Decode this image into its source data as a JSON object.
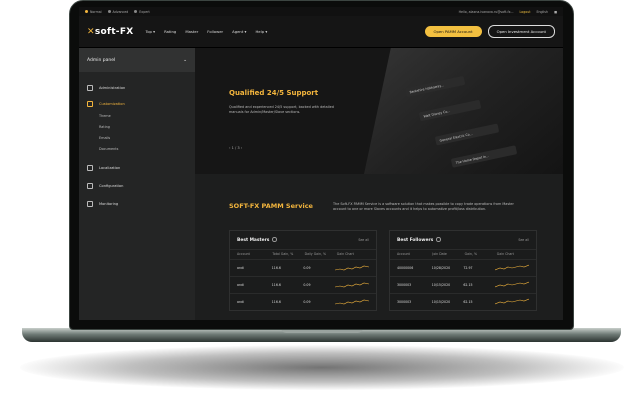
{
  "topbar": {
    "badges": [
      {
        "label": "Normal",
        "color": "#f3b53d"
      },
      {
        "label": "Advanced",
        "color": "#888888"
      },
      {
        "label": "Expert",
        "color": "#888888"
      }
    ],
    "email": "Hello, alaxna.ivanova.ru@soft-fx...",
    "login": "Logout",
    "lang": "English"
  },
  "nav": {
    "logo_x": "✕",
    "logo_text": "soft-FX",
    "items": [
      "Top ▾",
      "Rating",
      "Master",
      "Follower",
      "Agent ▾",
      "Help ▾"
    ],
    "open_pamm": "Open PAMM Account",
    "open_investment": "Open Investment Account"
  },
  "sidebar": {
    "title": "Admin panel",
    "items": [
      {
        "label": "Administration"
      },
      {
        "label": "Customization"
      },
      {
        "label": "Localization"
      },
      {
        "label": "Configuration"
      },
      {
        "label": "Monitoring"
      }
    ],
    "subitems": [
      "Theme",
      "Rating",
      "Emails",
      "Documents"
    ]
  },
  "hero": {
    "title": "Qualified 24/5 Support",
    "text": "Qualified and experienced 24/5 support, backed with detailed manuals for Admin/Master/Slave sections.",
    "pager": "‹   1 / 3   ›",
    "tickers": [
      "Berkshire Hathaway...",
      "Walt Disney Co...",
      "General Electric Co...",
      "The Home Depot In..."
    ]
  },
  "pamm": {
    "title": "SOFT-FX PAMM Service",
    "text": "The Soft-FX PAMM Service is a software solution that makes possible to copy trade operations from Master account to one or more Slaves accounts and it helps to automatize profit/loss distribution."
  },
  "masters": {
    "title": "Best Masters",
    "see_all": "See all",
    "columns": [
      "Account",
      "Total Gain, %",
      "Daily Gain, %",
      "Gain Chart"
    ],
    "rows": [
      [
        "andi",
        "116.6",
        "0.09",
        ""
      ],
      [
        "andi",
        "116.6",
        "0.09",
        ""
      ],
      [
        "andi",
        "116.6",
        "0.09",
        ""
      ]
    ]
  },
  "followers": {
    "title": "Best Followers",
    "see_all": "See all",
    "columns": [
      "Account",
      "Join Date",
      "Gain, %",
      "Gain Chart"
    ],
    "rows": [
      [
        "40000006",
        "10/28/2020",
        "72.97",
        ""
      ],
      [
        "3000003",
        "10/15/2020",
        "62.15",
        ""
      ],
      [
        "3000003",
        "10/15/2020",
        "62.15",
        ""
      ]
    ]
  },
  "colors": {
    "accent": "#f3b53d",
    "bg": "#1d1e1e"
  },
  "icons": [
    "user-icon",
    "sliders-icon",
    "monitor-icon",
    "gear-icon",
    "users-icon",
    "info-icon",
    "chevron-down-icon"
  ]
}
